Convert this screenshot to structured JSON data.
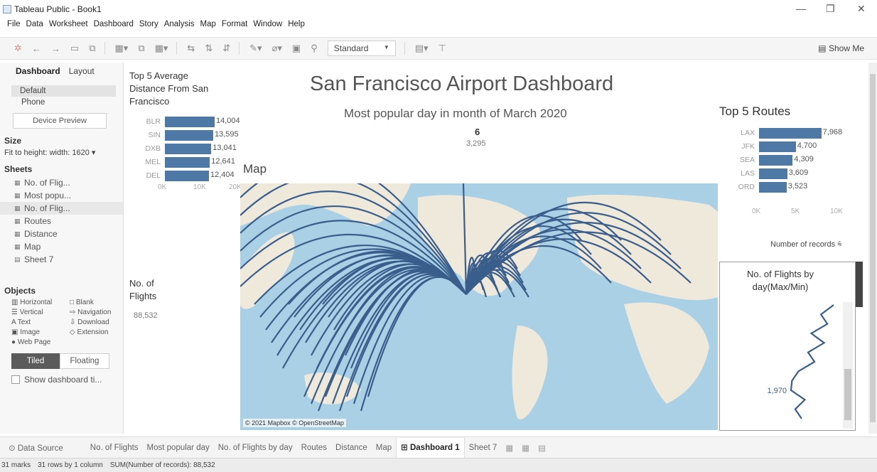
{
  "window": {
    "title": "Tableau Public - Book1",
    "minimize": "—",
    "restore": "❐",
    "close": "✕"
  },
  "menu": [
    "File",
    "Data",
    "Worksheet",
    "Dashboard",
    "Story",
    "Analysis",
    "Map",
    "Format",
    "Window",
    "Help"
  ],
  "toolbar": {
    "fit_select": "Standard",
    "show_me": "Show Me"
  },
  "left_panel": {
    "tabs": {
      "dashboard": "Dashboard",
      "layout": "Layout"
    },
    "devices": [
      "Default",
      "Phone"
    ],
    "device_preview": "Device Preview",
    "size_title": "Size",
    "size_value": "Fit to height: width: 1620 ▾",
    "sheets_title": "Sheets",
    "sheets": [
      "No. of Flig...",
      "Most popu...",
      "No. of Flig...",
      "Routes",
      "Distance",
      "Map",
      "Sheet 7"
    ],
    "objects_title": "Objects",
    "objects": [
      "Horizontal",
      "Blank",
      "Vertical",
      "Navigation",
      "Text",
      "Download",
      "Image",
      "Extension",
      "Web Page"
    ],
    "tiled": "Tiled",
    "floating": "Floating",
    "show_title": "Show dashboard ti..."
  },
  "dashboard": {
    "title": "San Francisco Airport Dashboard",
    "popular_day_title": "Most popular day in month of March 2020",
    "popular_day": "6",
    "popular_day_count": "3,295",
    "map_label": "Map",
    "map_credit": "© 2021 Mapbox © OpenStreetMap",
    "flights_label": "No. of Flights",
    "flights_value": "88,532",
    "records_label": "Number of records ⩯",
    "float_title": "No. of Flights by day(Max/Min)",
    "float_value": "1,970"
  },
  "chart_data": [
    {
      "type": "bar",
      "title": "Top 5 Average Distance From San Francisco",
      "categories": [
        "BLR",
        "SIN",
        "DXB",
        "MEL",
        "DEL"
      ],
      "values": [
        14004,
        13595,
        13041,
        12641,
        12404
      ],
      "value_labels": [
        "14,004",
        "13,595",
        "13,041",
        "12,641",
        "12,404"
      ],
      "xticks": [
        "0K",
        "10K",
        "20K"
      ],
      "xlim": [
        0,
        20000
      ]
    },
    {
      "type": "bar",
      "title": "Top 5 Routes",
      "categories": [
        "LAX",
        "JFK",
        "SEA",
        "LAS",
        "ORD"
      ],
      "values": [
        7968,
        4700,
        4309,
        3609,
        3523
      ],
      "value_labels": [
        "7,968",
        "4,700",
        "4,309",
        "3,609",
        "3,523"
      ],
      "xticks": [
        "0K",
        "5K",
        "10K"
      ],
      "xlim": [
        0,
        10000
      ]
    },
    {
      "type": "line",
      "title": "No. of Flights by day(Max/Min)",
      "values": [
        3295,
        2900,
        3100,
        2600,
        3000,
        2500,
        2700,
        2200,
        2000,
        1970,
        2400,
        2100,
        2300
      ],
      "label": "1,970"
    }
  ],
  "tabs": [
    "Data Source",
    "No. of Flights",
    "Most popular day",
    "No. of Flights by day",
    "Routes",
    "Distance",
    "Map",
    "Dashboard 1",
    "Sheet 7"
  ],
  "active_tab": "Dashboard 1",
  "status": {
    "marks": "31 marks",
    "rows": "31 rows by 1 column",
    "sum": "SUM(Number of records): 88,532"
  },
  "colors": {
    "bar": "#4e79a7",
    "ocean": "#a9d0e4",
    "land": "#efe9dc",
    "route": "#3a5e8c"
  }
}
